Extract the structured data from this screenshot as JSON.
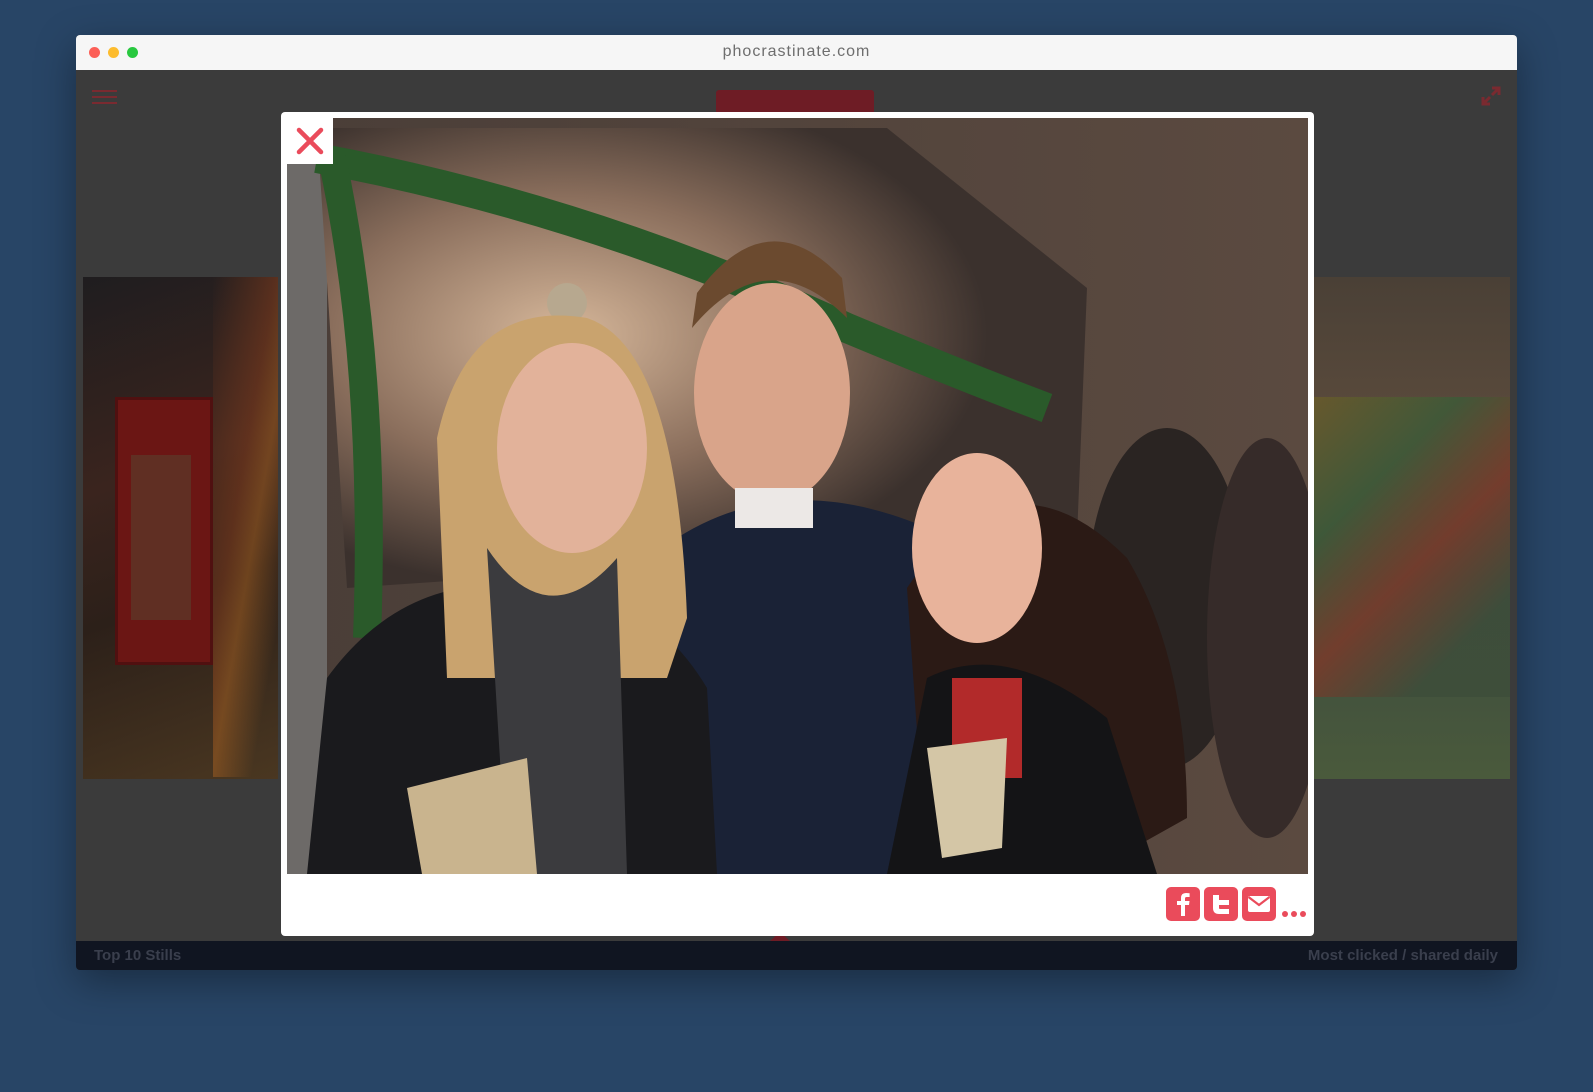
{
  "browser": {
    "url": "phocrastinate.com"
  },
  "footer": {
    "left_label": "Top 10 Stills",
    "right_label": "Most clicked / shared daily"
  },
  "icons": {
    "menu": "hamburger-icon",
    "expand": "expand-arrows-icon",
    "close": "close-icon",
    "facebook": "facebook-icon",
    "twitter": "twitter-icon",
    "email": "email-icon",
    "more": "more-dots-icon"
  },
  "colors": {
    "page_background": "#284566",
    "accent": "#ea4b5b",
    "header_accent": "#6e1c25",
    "footer_background": "#101521"
  }
}
